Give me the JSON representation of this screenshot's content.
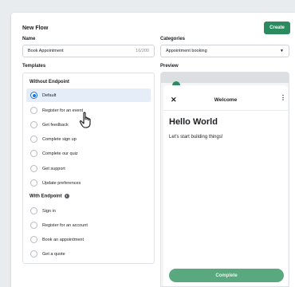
{
  "header": {
    "title": "New Flow",
    "create_label": "Create"
  },
  "name_field": {
    "label": "Name",
    "value": "Book Appointment",
    "counter": "16/200"
  },
  "categories_field": {
    "label": "Categories",
    "value": "Appointment booking"
  },
  "templates": {
    "label": "Templates",
    "without_endpoint": {
      "heading": "Without Endpoint",
      "items": [
        {
          "label": "Default",
          "selected": true
        },
        {
          "label": "Register for an event"
        },
        {
          "label": "Get feedback"
        },
        {
          "label": "Complete sign up"
        },
        {
          "label": "Complete our quiz"
        },
        {
          "label": "Get support"
        },
        {
          "label": "Update preferences"
        }
      ]
    },
    "with_endpoint": {
      "heading": "With Endpoint",
      "items": [
        {
          "label": "Sign in"
        },
        {
          "label": "Register for an account"
        },
        {
          "label": "Book an appointment"
        },
        {
          "label": "Get a quote"
        }
      ]
    }
  },
  "preview": {
    "label": "Preview",
    "sheet_title": "Welcome",
    "heading": "Hello World",
    "body": "Let's start building things!",
    "button": "Complete"
  }
}
